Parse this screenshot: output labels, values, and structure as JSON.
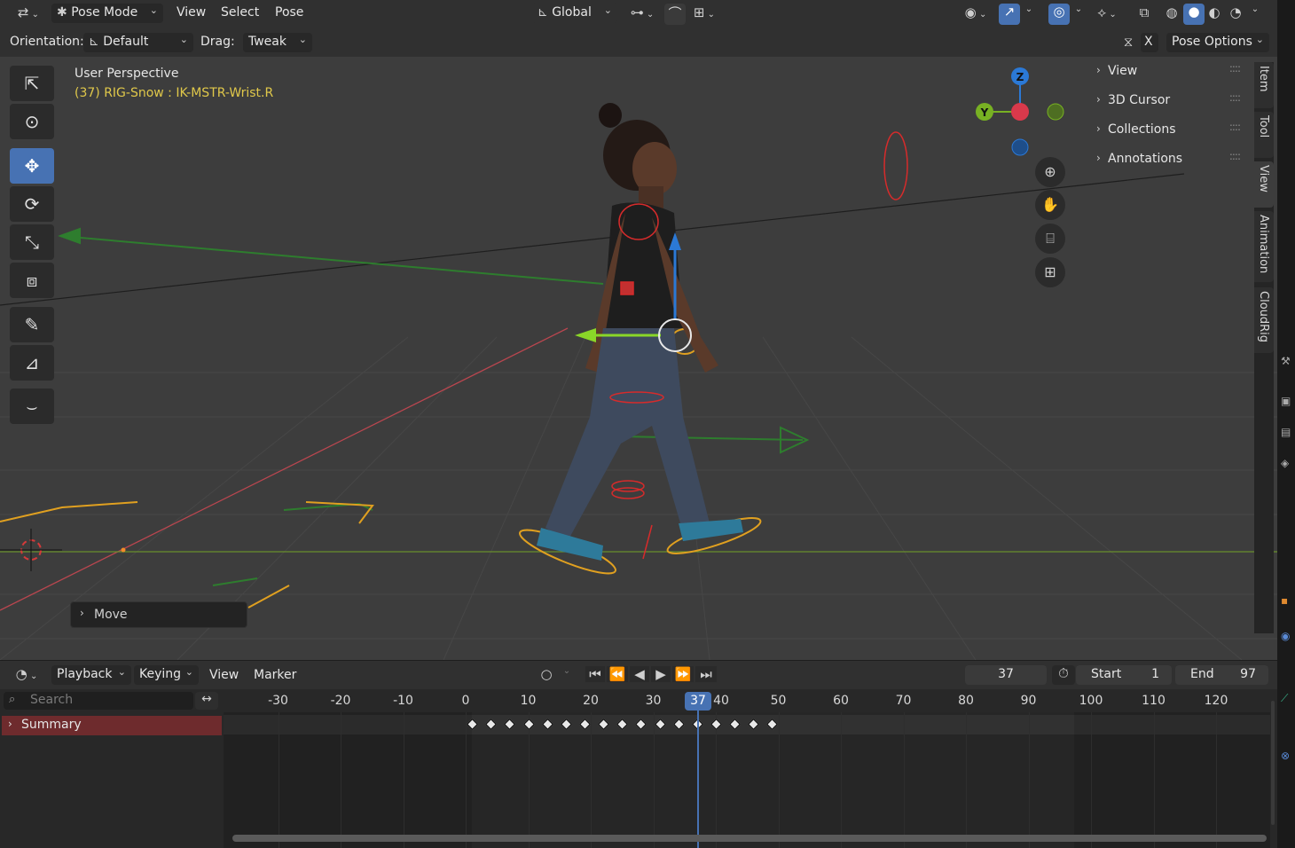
{
  "header": {
    "editor_type_icon": "axis-icon",
    "mode": "Pose Mode",
    "menus": [
      "View",
      "Select",
      "Pose"
    ],
    "transform_orientation": "Global",
    "pose_options": "Pose Options",
    "x_mirror": "X"
  },
  "tool_header": {
    "orientation_label": "Orientation:",
    "orientation_value": "Default",
    "drag_label": "Drag:",
    "drag_value": "Tweak"
  },
  "viewport": {
    "perspective_label": "User Perspective",
    "active_bone_info": "(37) RIG-Snow : IK-MSTR-Wrist.R",
    "gizmo_axes": [
      "Z",
      "Y"
    ],
    "last_operator": "Move",
    "colors": {
      "bg": "#3d3d3d",
      "info_yellow": "#e0c84a",
      "axis_x": "#d9394b",
      "axis_y": "#78b123",
      "axis_z": "#2b79d6",
      "accent": "#4772b3"
    }
  },
  "npanel": {
    "sections": [
      "View",
      "3D Cursor",
      "Collections",
      "Annotations"
    ],
    "tabs": [
      "Item",
      "Tool",
      "View",
      "Animation",
      "CloudRig"
    ],
    "active_tab": "View"
  },
  "timeline": {
    "menus": [
      "Playback",
      "Keying",
      "View",
      "Marker"
    ],
    "current_frame": "37",
    "start_label": "Start",
    "start_value": "1",
    "end_label": "End",
    "end_value": "97",
    "search_placeholder": "Search",
    "summary_label": "Summary",
    "ruler": [
      "-30",
      "-20",
      "-10",
      "0",
      "10",
      "20",
      "30",
      "40",
      "50",
      "60",
      "70",
      "80",
      "90",
      "100",
      "110",
      "120"
    ],
    "playhead_label": "37",
    "keyframes": [
      1,
      4,
      7,
      10,
      13,
      16,
      19,
      22,
      25,
      28,
      31,
      34,
      37,
      40,
      43,
      46,
      49
    ]
  }
}
